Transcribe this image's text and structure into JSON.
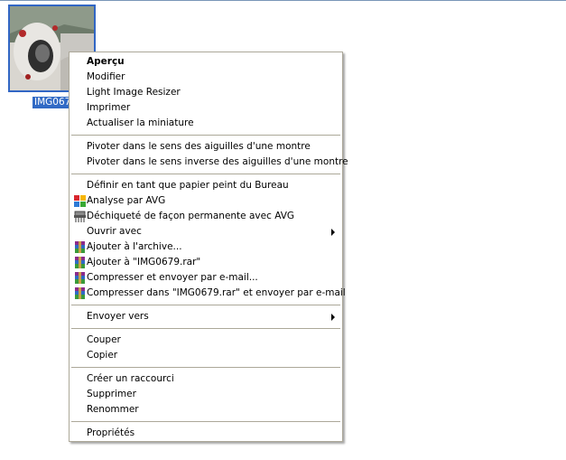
{
  "file": {
    "name": "IMG067"
  },
  "menu": {
    "open_with_arrow": "submenu",
    "items": [
      {
        "label": "Aperçu"
      },
      {
        "label": "Modifier"
      },
      {
        "label": "Light Image Resizer"
      },
      {
        "label": "Imprimer"
      },
      {
        "label": "Actualiser la miniature"
      },
      {
        "label": "Pivoter dans le sens des aiguilles d'une montre"
      },
      {
        "label": "Pivoter dans le sens inverse des aiguilles d'une montre"
      },
      {
        "label": "Définir en tant que papier peint du Bureau"
      },
      {
        "label": "Analyse par AVG",
        "icon": "avg-icon"
      },
      {
        "label": "Déchiqueté de façon permanente avec AVG",
        "icon": "shredder-icon"
      },
      {
        "label": "Ouvrir avec"
      },
      {
        "label": "Ajouter à l'archive...",
        "icon": "winrar-icon"
      },
      {
        "label": "Ajouter à \"IMG0679.rar\"",
        "icon": "winrar-icon"
      },
      {
        "label": "Compresser et envoyer par e-mail...",
        "icon": "winrar-icon"
      },
      {
        "label": "Compresser dans \"IMG0679.rar\" et envoyer par e-mail",
        "icon": "winrar-icon"
      },
      {
        "label": "Envoyer vers"
      },
      {
        "label": "Couper"
      },
      {
        "label": "Copier"
      },
      {
        "label": "Créer un raccourci"
      },
      {
        "label": "Supprimer"
      },
      {
        "label": "Renommer"
      },
      {
        "label": "Propriétés"
      }
    ]
  },
  "colors": {
    "selection": "#316ac5",
    "menu_border": "#aca899",
    "separator": "#aca899"
  }
}
